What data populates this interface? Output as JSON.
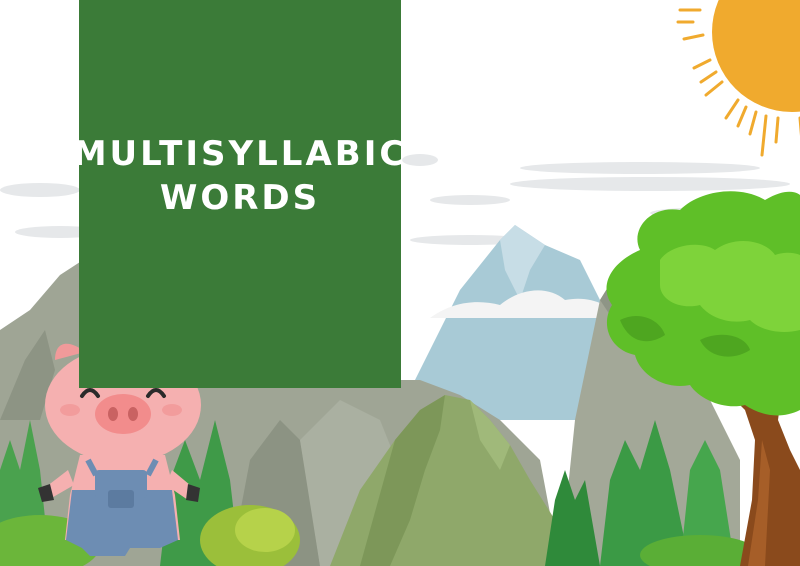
{
  "title": {
    "line1": "MULTISYLLABIC",
    "line2": "WORDS"
  },
  "colors": {
    "panel": "#3b7b38",
    "sun": "#f0aa2e",
    "tree_leaves": "#5fbf28",
    "trunk": "#8a4a1c",
    "mountains_gray": "#9fa595",
    "mountain_blue": "#a8cad6",
    "pig_pink": "#f5b0b0",
    "overalls": "#6d8db3"
  },
  "icons": [
    "sun-icon",
    "pig-icon",
    "tree-icon",
    "mountains-icon",
    "clouds-icon"
  ]
}
